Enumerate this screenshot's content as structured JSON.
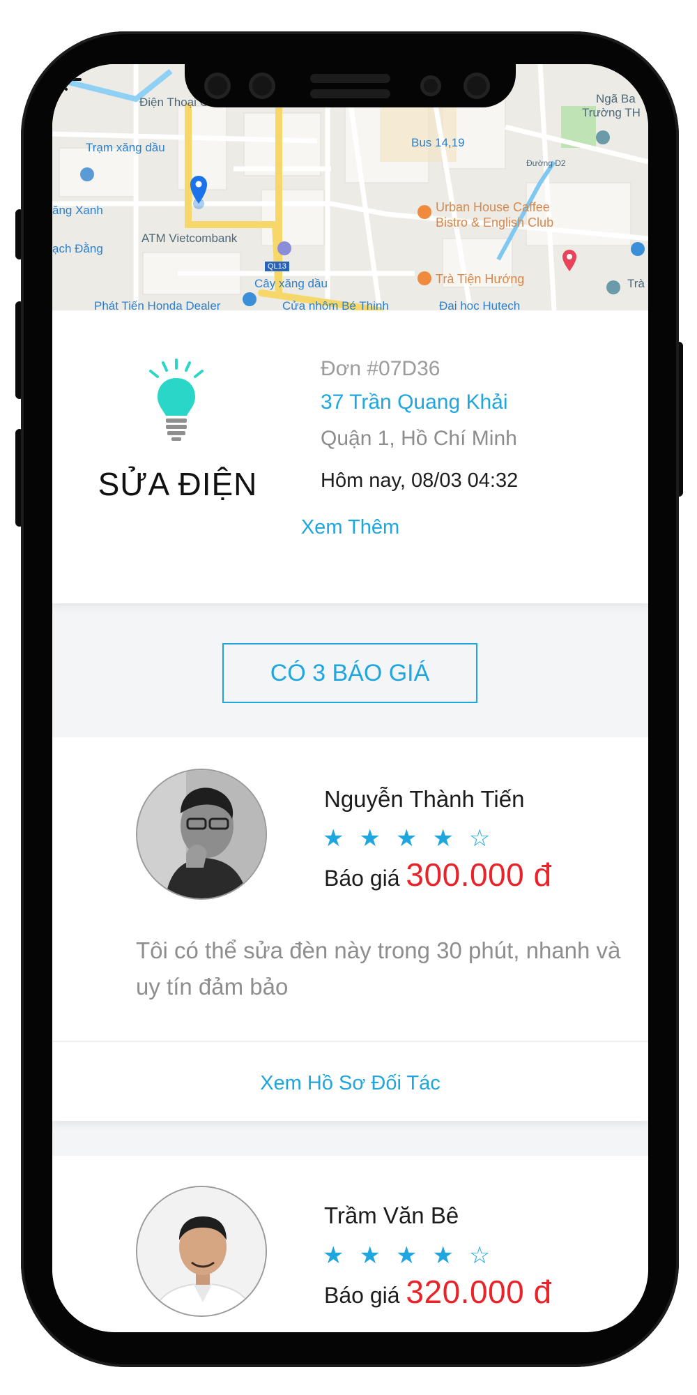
{
  "map": {
    "labels": {
      "dien_thoai": "Điện Thoại Giá Vĩnh",
      "tram_xang": "Trạm xăng dầu",
      "ang_xanh": "ăng Xanh",
      "bach_dang": "ạch Đằng",
      "atm": "ATM Vietcombank",
      "cay_xang": "Cây xăng dầu",
      "ql13": "QL13",
      "bus": "Bus 14,19",
      "urban1": "Urban House Caffee",
      "urban2": "Bistro & English Club",
      "tra_tien": "Trà Tiện Hướng",
      "nga_ba": "Ngã Ba",
      "truong": "Trường TH",
      "duong": "Đường D2",
      "dai_hoc": "Đại học Hutech",
      "cua_nhom": "Cửa nhôm Bé Thịnh",
      "tra": "Trà",
      "phat_tien": "Phát Tiến Honda Dealer"
    }
  },
  "order": {
    "service_icon": "lightbulb-icon",
    "service_name": "SỬA ĐIỆN",
    "id": "Đơn #07D36",
    "address_line1": "37 Trần Quang Khải",
    "address_line2": "Quận 1, Hồ Chí Minh",
    "time": "Hôm nay, 08/03 04:32",
    "more_link": "Xem Thêm"
  },
  "quotes_button": "CÓ 3 BÁO GIÁ",
  "partners": [
    {
      "name": "Nguyễn Thành Tiến",
      "rating": 4,
      "stars": "★★★★☆",
      "price_label": "Báo giá",
      "price": "300.000 đ",
      "message": "Tôi có thể sửa đèn này trong 30 phút, nhanh và uy tín đảm bảo",
      "profile_link": "Xem Hồ Sơ Đối Tác"
    },
    {
      "name": "Trầm Văn Bê",
      "rating": 4,
      "stars": "★★★★☆",
      "price_label": "Báo giá",
      "price": "320.000 đ"
    }
  ],
  "colors": {
    "accent": "#1fa6de",
    "price": "#e8242a",
    "bulb": "#2ad6c7"
  }
}
